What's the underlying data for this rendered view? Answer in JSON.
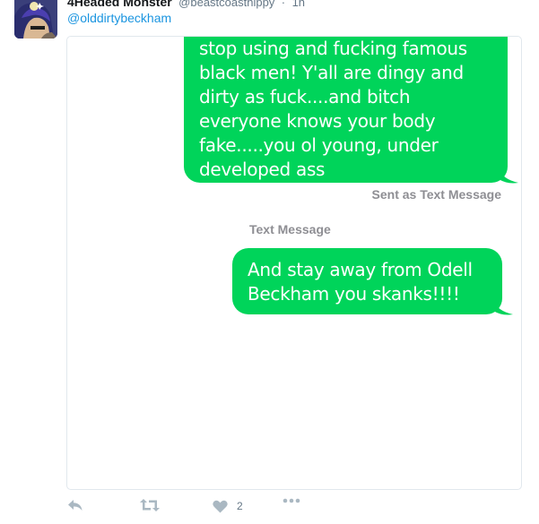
{
  "tweet": {
    "display_name": "4Headed Monster",
    "screen_name": "@beastcoasthippy",
    "separator": "·",
    "time": "1h",
    "mention": "@olddirtybeckham"
  },
  "imessage": {
    "bubble_top_text": "stop using and fucking famous\nblack men! Y'all are dingy and\ndirty as fuck....and bitch\neveryone knows your body\nfake.....you ol young, under\ndeveloped ass",
    "sent_label": "Sent as Text Message",
    "section_label": "Text Message",
    "bubble_bottom_text": "And stay away from Odell\nBeckham you skanks!!!!",
    "bubble_color": "#00d45a"
  },
  "actions": {
    "reply_icon": "reply-icon",
    "retweet_icon": "retweet-icon",
    "like_icon": "heart-icon",
    "like_count": "2",
    "more_icon": "more-icon"
  },
  "colors": {
    "link": "#1b95e0",
    "muted": "#657786",
    "label_gray": "#8e8e93",
    "icon_gray": "#aab8c2"
  }
}
